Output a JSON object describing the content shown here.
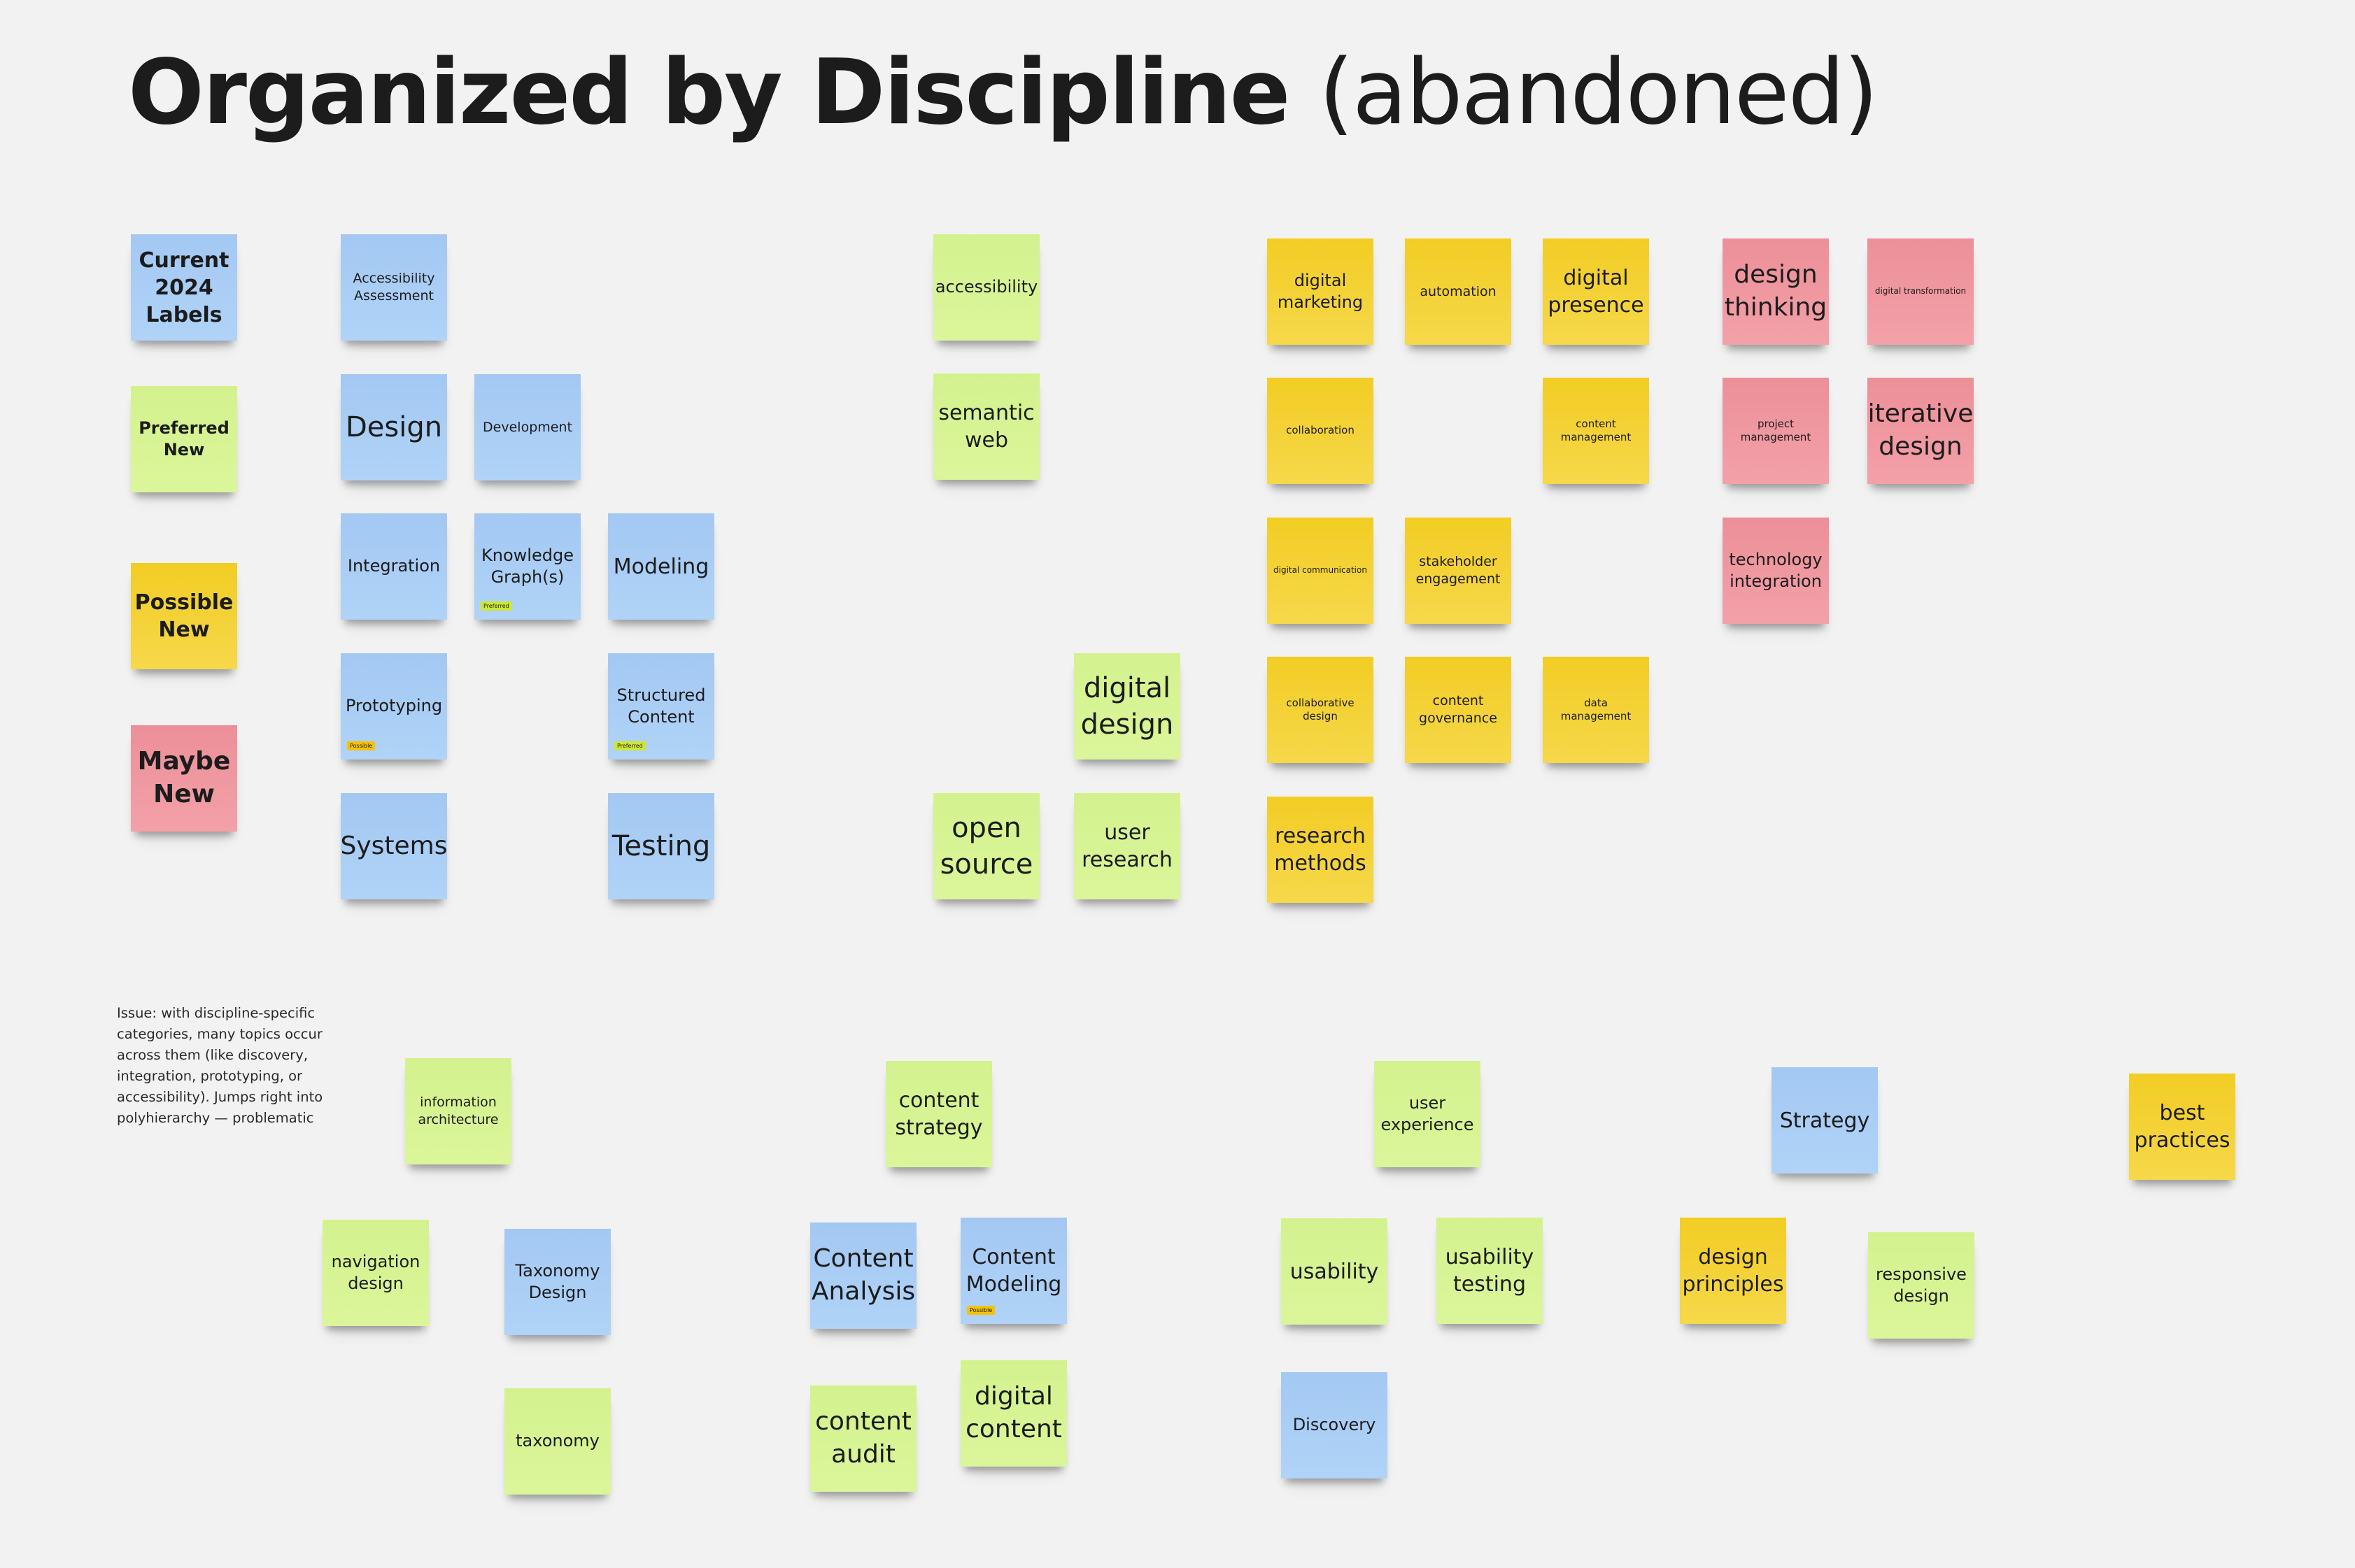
{
  "title": {
    "bold": "Organized by Discipline",
    "light": "(abandoned)"
  },
  "legend": {
    "current": "Current 2024 Labels",
    "preferred": "Preferred New",
    "possible": "Possible New",
    "maybe": "Maybe New"
  },
  "colors": {
    "current": "#a8cdf4",
    "preferred": "#d7f494",
    "possible": "#f4d232",
    "maybe": "#ef99a1",
    "background": "#f2f2f2",
    "tag_preferred": "#cde833",
    "tag_possible": "#f5c20b"
  },
  "tags": {
    "preferred": "Preferred",
    "possible": "Possible"
  },
  "note": "Issue: with discipline-specific categories, many topics occur across them (like discovery, integration, prototyping, or accessibility). Jumps right into polyhierarchy — problematic",
  "stickies": {
    "accessibility_assessment": "Accessibility Assessment",
    "design": "Design",
    "development": "Development",
    "integration": "Integration",
    "knowledge_graphs": "Knowledge Graph(s)",
    "modeling": "Modeling",
    "prototyping": "Prototyping",
    "structured_content": "Structured Content",
    "systems": "Systems",
    "testing": "Testing",
    "accessibility": "accessibility",
    "semantic_web": "semantic web",
    "digital_design": "digital design",
    "open_source": "open source",
    "user_research": "user research",
    "digital_marketing": "digital marketing",
    "automation": "automation",
    "digital_presence": "digital presence",
    "collaboration": "collaboration",
    "content_management": "content management",
    "digital_communication": "digital communication",
    "stakeholder_engagement": "stakeholder engagement",
    "collaborative_design": "collaborative design",
    "content_governance": "content governance",
    "data_management": "data management",
    "research_methods": "research methods",
    "design_thinking": "design thinking",
    "digital_transformation": "digital transformation",
    "project_management": "project management",
    "iterative_design": "iterative design",
    "technology_integration": "technology integration",
    "information_architecture": "information architecture",
    "navigation_design": "navigation design",
    "taxonomy_design": "Taxonomy Design",
    "taxonomy": "taxonomy",
    "content_strategy": "content strategy",
    "content_analysis": "Content Analysis",
    "content_modeling": "Content Modeling",
    "content_audit": "content audit",
    "digital_content": "digital content",
    "user_experience": "user experience",
    "usability": "usability",
    "usability_testing": "usability testing",
    "discovery": "Discovery",
    "strategy": "Strategy",
    "design_principles": "design principles",
    "responsive_design": "responsive design",
    "best_practices": "best practices"
  }
}
